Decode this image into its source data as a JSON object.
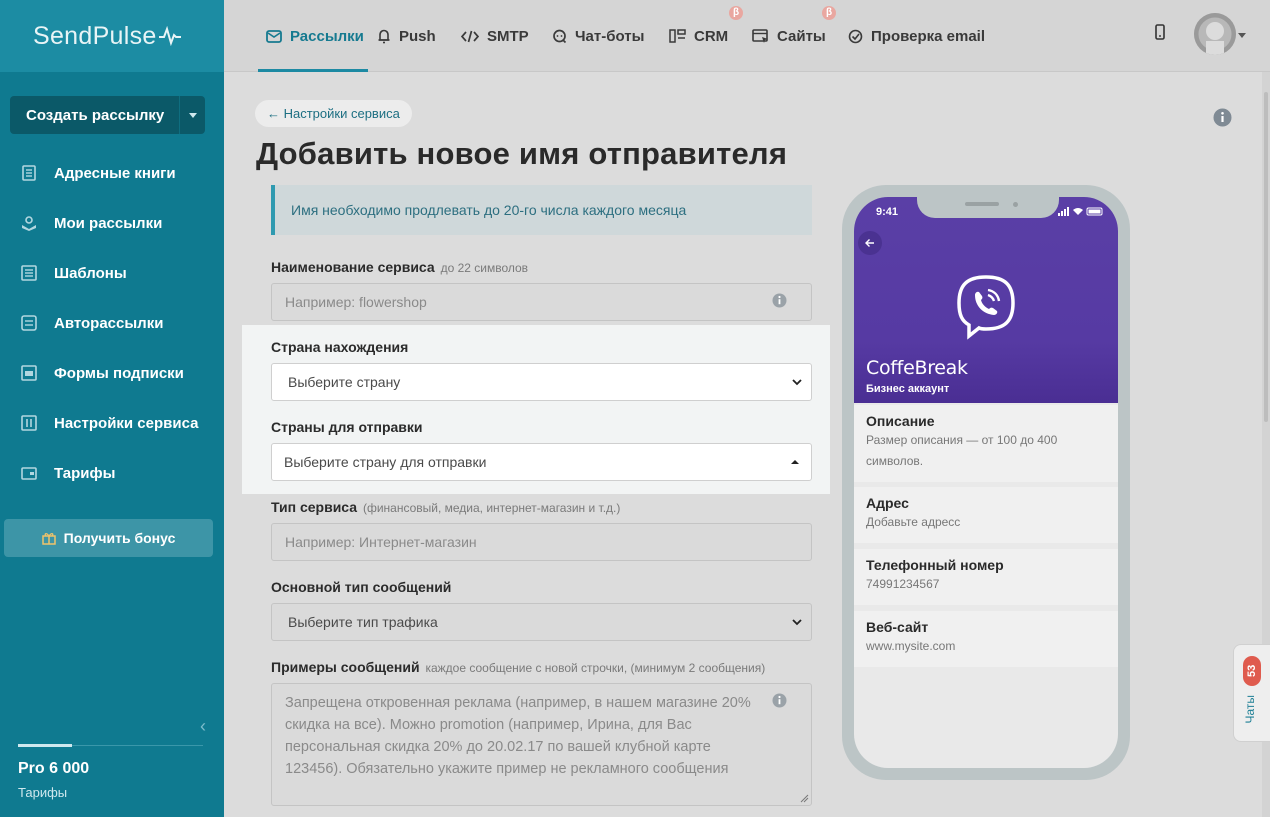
{
  "app": {
    "logo": "SendPulse"
  },
  "sidebar": {
    "create_button": "Создать рассылку",
    "items": [
      {
        "label": "Адресные книги",
        "icon": "address-book-icon"
      },
      {
        "label": "Мои рассылки",
        "icon": "campaigns-icon"
      },
      {
        "label": "Шаблоны",
        "icon": "templates-icon"
      },
      {
        "label": "Авторассылки",
        "icon": "automation-icon"
      },
      {
        "label": "Формы подписки",
        "icon": "forms-icon"
      },
      {
        "label": "Настройки сервиса",
        "icon": "settings-icon"
      },
      {
        "label": "Тарифы",
        "icon": "pricing-icon"
      }
    ],
    "bonus_button": "Получить бонус",
    "plan_name": "Pro 6 000",
    "plan_link": "Тарифы"
  },
  "topnav": {
    "tabs": [
      {
        "label": "Рассылки",
        "icon": "mail-icon",
        "active": true
      },
      {
        "label": "Push",
        "icon": "bell-icon"
      },
      {
        "label": "SMTP",
        "icon": "code-icon"
      },
      {
        "label": "Чат-боты",
        "icon": "chatbot-icon"
      },
      {
        "label": "CRM",
        "icon": "crm-icon",
        "beta": "β"
      },
      {
        "label": "Сайты",
        "icon": "sites-icon",
        "beta": "β"
      },
      {
        "label": "Проверка email",
        "icon": "check-icon"
      }
    ]
  },
  "page": {
    "back_link": "← Настройки сервиса",
    "title": "Добавить новое имя отправителя",
    "alert": "Имя необходимо продлевать до 20-го числа каждого месяца"
  },
  "form": {
    "service_name": {
      "label": "Наименование сервиса",
      "hint": "до 22 символов",
      "placeholder": "Например: flowershop"
    },
    "country": {
      "label": "Страна нахождения",
      "value": "Выберите страну"
    },
    "send_countries": {
      "label": "Страны для отправки",
      "value": "Выберите страну для отправки"
    },
    "service_type": {
      "label": "Тип сервиса",
      "hint": "(финансовый, медиа, интернет-магазин и т.д.)",
      "placeholder": "Например: Интернет-магазин"
    },
    "message_type": {
      "label": "Основной тип сообщений",
      "value": "Выберите тип трафика"
    },
    "examples": {
      "label": "Примеры сообщений",
      "hint": "каждое сообщение с новой строчки, (минимум 2 сообщения)",
      "placeholder": "Запрещена откровенная реклама (например, в нашем магазине 20% скидка на все). Можно promotion (например, Ирина, для Вас персональная скидка 20% до 20.02.17 по вашей клубной карте 123456). Обязательно укажите пример не рекламного сообщения"
    }
  },
  "preview": {
    "time": "9:41",
    "business_name": "CoffeBreak",
    "business_sub": "Бизнес аккаунт",
    "cards": [
      {
        "title": "Описание",
        "text": "Размер описания — от 100 до 400 символов."
      },
      {
        "title": "Адрес",
        "text": "Добавьте адресс"
      },
      {
        "title": "Телефонный номер",
        "text": "74991234567"
      },
      {
        "title": "Веб-сайт",
        "text": "www.mysite.com"
      }
    ]
  },
  "chat_widget": {
    "count": "53",
    "label": "Чаты"
  },
  "colors": {
    "sidebar": "#0f7a90",
    "accent": "#1d8aa3",
    "viber": "#5a3fa6",
    "badge": "#df5b4e"
  }
}
